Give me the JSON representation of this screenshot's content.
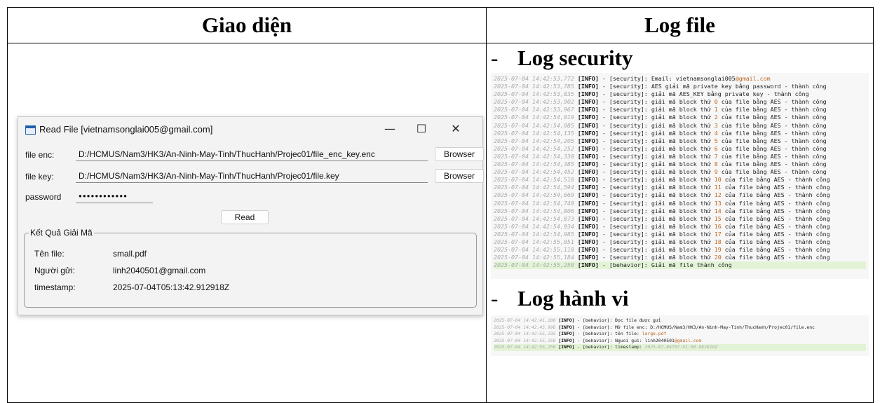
{
  "headers": {
    "left": "Giao diện",
    "right": "Log file"
  },
  "window": {
    "title": "Read File [vietnamsonglai005@gmail.com]",
    "minimize": "—",
    "maximize": "☐",
    "close": "✕",
    "file_enc_label": "file enc:",
    "file_enc_value": "D:/HCMUS/Nam3/HK3/An-Ninh-May-Tinh/ThucHanh/Projec01/file_enc_key.enc",
    "file_key_label": "file key:",
    "file_key_value": "D:/HCMUS/Nam3/HK3/An-Ninh-May-Tinh/ThucHanh/Projec01/file.key",
    "browse_label": "Browser",
    "password_label": "password",
    "password_mask": "●●●●●●●●●●●●",
    "read_label": "Read",
    "group_title": "Kết Quả Giải Mã",
    "result_filename_label": "Tên file:",
    "result_filename_value": "small.pdf",
    "result_sender_label": "Người gửi:",
    "result_sender_value": "linh2040501@gmail.com",
    "result_timestamp_label": "timestamp:",
    "result_timestamp_value": "2025-07-04T05:13:42.912918Z"
  },
  "log_security": {
    "dash": "-",
    "title": "Log security",
    "lines": [
      {
        "ts": "2025-07-04 14:42:53,772",
        "tag": "[INFO]",
        "src": " - [security]: ",
        "msg": "Email: vietnamsonglai005",
        "dom": "@gmail.com"
      },
      {
        "ts": "2025-07-04 14:42:53,785",
        "tag": "[INFO]",
        "src": " - [security]: ",
        "msg": "AES giải mã private key bằng password - thành công"
      },
      {
        "ts": "2025-07-04 14:42:53,835",
        "tag": "[INFO]",
        "src": " - [security]: ",
        "msg": "giải mã AES_KEY bằng private key - thành công"
      },
      {
        "ts": "2025-07-04 14:42:53,902",
        "tag": "[INFO]",
        "src": " - [security]: ",
        "pre": "giải mã block thứ ",
        "num": "0",
        "post": " của file bằng AES - thành công"
      },
      {
        "ts": "2025-07-04 14:42:53,967",
        "tag": "[INFO]",
        "src": " - [security]: ",
        "pre": "giải mã block thứ ",
        "num": "1",
        "post": " của file bằng AES - thành công"
      },
      {
        "ts": "2025-07-04 14:42:54,019",
        "tag": "[INFO]",
        "src": " - [security]: ",
        "pre": "giải mã block thứ ",
        "num": "2",
        "post": " của file bằng AES - thành công"
      },
      {
        "ts": "2025-07-04 14:42:54,085",
        "tag": "[INFO]",
        "src": " - [security]: ",
        "pre": "giải mã block thứ ",
        "num": "3",
        "post": " của file bằng AES - thành công"
      },
      {
        "ts": "2025-07-04 14:42:54,135",
        "tag": "[INFO]",
        "src": " - [security]: ",
        "pre": "giải mã block thứ ",
        "num": "4",
        "post": " của file bằng AES - thành công"
      },
      {
        "ts": "2025-07-04 14:42:54,205",
        "tag": "[INFO]",
        "src": " - [security]: ",
        "pre": "giải mã block thứ ",
        "num": "5",
        "post": " của file bằng AES - thành công"
      },
      {
        "ts": "2025-07-04 14:42:54,252",
        "tag": "[INFO]",
        "src": " - [security]: ",
        "pre": "giải mã block thứ ",
        "num": "6",
        "post": " của file bằng AES - thành công"
      },
      {
        "ts": "2025-07-04 14:42:54,330",
        "tag": "[INFO]",
        "src": " - [security]: ",
        "pre": "giải mã block thứ ",
        "num": "7",
        "post": " của file bằng AES - thành công"
      },
      {
        "ts": "2025-07-04 14:42:54,385",
        "tag": "[INFO]",
        "src": " - [security]: ",
        "pre": "giải mã block thứ ",
        "num": "8",
        "post": " của file bằng AES - thành công"
      },
      {
        "ts": "2025-07-04 14:42:54,452",
        "tag": "[INFO]",
        "src": " - [security]: ",
        "pre": "giải mã block thứ ",
        "num": "9",
        "post": " của file bằng AES - thành công"
      },
      {
        "ts": "2025-07-04 14:42:54,518",
        "tag": "[INFO]",
        "src": " - [security]: ",
        "pre": "giải mã block thứ ",
        "num": "10",
        "post": " của file bằng AES - thành công"
      },
      {
        "ts": "2025-07-04 14:42:54,594",
        "tag": "[INFO]",
        "src": " - [security]: ",
        "pre": "giải mã block thứ ",
        "num": "11",
        "post": " của file bằng AES - thành công"
      },
      {
        "ts": "2025-07-04 14:42:54,669",
        "tag": "[INFO]",
        "src": " - [security]: ",
        "pre": "giải mã block thứ ",
        "num": "12",
        "post": " của file bằng AES - thành công"
      },
      {
        "ts": "2025-07-04 14:42:54,740",
        "tag": "[INFO]",
        "src": " - [security]: ",
        "pre": "giải mã block thứ ",
        "num": "13",
        "post": " của file bằng AES - thành công"
      },
      {
        "ts": "2025-07-04 14:42:54,806",
        "tag": "[INFO]",
        "src": " - [security]: ",
        "pre": "giải mã block thứ ",
        "num": "14",
        "post": " của file bằng AES - thành công"
      },
      {
        "ts": "2025-07-04 14:42:54,873",
        "tag": "[INFO]",
        "src": " - [security]: ",
        "pre": "giải mã block thứ ",
        "num": "15",
        "post": " của file bằng AES - thành công"
      },
      {
        "ts": "2025-07-04 14:42:54,934",
        "tag": "[INFO]",
        "src": " - [security]: ",
        "pre": "giải mã block thứ ",
        "num": "16",
        "post": " của file bằng AES - thành công"
      },
      {
        "ts": "2025-07-04 14:42:54,985",
        "tag": "[INFO]",
        "src": " - [security]: ",
        "pre": "giải mã block thứ ",
        "num": "17",
        "post": " của file bằng AES - thành công"
      },
      {
        "ts": "2025-07-04 14:42:55,051",
        "tag": "[INFO]",
        "src": " - [security]: ",
        "pre": "giải mã block thứ ",
        "num": "18",
        "post": " của file bằng AES - thành công"
      },
      {
        "ts": "2025-07-04 14:42:55,118",
        "tag": "[INFO]",
        "src": " - [security]: ",
        "pre": "giải mã block thứ ",
        "num": "19",
        "post": " của file bằng AES - thành công"
      },
      {
        "ts": "2025-07-04 14:42:55,184",
        "tag": "[INFO]",
        "src": " - [security]: ",
        "pre": "giải mã block thứ ",
        "num": "20",
        "post": " của file bằng AES - thành công"
      },
      {
        "ts": "2025-07-04 14:42:55,250",
        "tag": "[INFO]",
        "src": " - [behavior]: ",
        "msg": "Giải mã file thành công",
        "hl": true
      }
    ]
  },
  "log_behavior": {
    "dash": "-",
    "title": "Log hành vi",
    "lines": [
      {
        "ts": "2025-07-04 14:42:41,100",
        "tag": "[INFO]",
        "src": " - [behavior]: ",
        "msg": "Đọc file được gửi"
      },
      {
        "ts": "2025-07-04 14:42:45,998",
        "tag": "[INFO]",
        "src": " - [behavior]: ",
        "msg": "Mở file enc: D:/HCMUS/Nam3/HK3/An-Ninh-May-Tinh/ThucHanh/Projec01/file.enc"
      },
      {
        "ts": "2025-07-04 14:42:55,235",
        "tag": "[INFO]",
        "src": " - [behavior]: ",
        "msg": "tên file: ",
        "dom": "large.pdf"
      },
      {
        "ts": "2025-07-04 14:42:55,250",
        "tag": "[INFO]",
        "src": " - [behavior]: ",
        "msg": "Nguoi gui: linh2040501",
        "dom": "@gmail.com"
      },
      {
        "ts": "2025-07-04 14:42:55,250",
        "tag": "[INFO]",
        "src": " - [behavior]: ",
        "msg": "timestamp: ",
        "ts2": "2025-07-04T07:41:50.882816Z",
        "hl": true
      }
    ]
  }
}
